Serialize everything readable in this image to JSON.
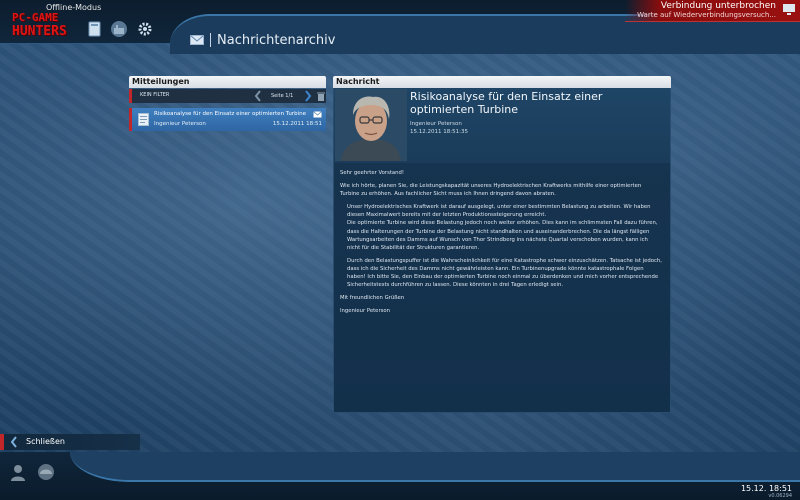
{
  "app": {
    "offline_mode": "Offline-Modus",
    "logo_line1": "PC-GAME",
    "logo_line2": "HUNTERS"
  },
  "connection": {
    "title": "Verbindung unterbrochen",
    "subtitle": "Warte auf Wiederverbindungsversuch..."
  },
  "header": {
    "title": "Nachrichtenarchiv"
  },
  "messages_panel": {
    "title": "Mitteilungen",
    "filter_label": "KEIN FILTER",
    "page_label": "Seite 1/1",
    "items": [
      {
        "subject": "Risikoanalyse für den Einsatz einer optimierten Turbine",
        "sender": "Ingenieur Peterson",
        "date": "15.12.2011 18:51"
      }
    ]
  },
  "message_panel": {
    "title": "Nachricht",
    "subject": "Risikoanalyse für den Einsatz einer optimierten Turbine",
    "sender": "Ingenieur Peterson",
    "timestamp": "15.12.2011 18:51:35",
    "greeting": "Sehr geehrter Vorstand!",
    "para1": "Wie ich hörte, planen Sie, die Leistungskapazität unseres Hydroelektrischen Kraftwerks mithilfe einer optimierten Turbine zu erhöhen. Aus fachlicher Sicht muss ich Ihnen dringend davon abraten.",
    "para2": "Unser Hydroelektrisches Kraftwerk ist darauf ausgelegt, unter einer bestimmten Belastung zu arbeiten. Wir haben diesen Maximalwert bereits mit der letzten Produktionssteigerung erreicht.",
    "para3": "Die optimierte Turbine wird diese Belastung jedoch noch weiter erhöhen. Dies kann im schlimmsten Fall dazu führen, dass die Halterungen der Turbine der Belastung nicht standhalten und auseinanderbrechen. Die da längst fälligen Wartungsarbeiten des Damms auf Wunsch von Thor Strindberg ins nächste Quartal verschoben wurden, kann ich nicht für die Stabilität der Strukturen garantieren.",
    "para4": "Durch den Belastungspuffer ist die Wahrscheinlichkeit für eine Katastrophe schwer einzuschätzen. Tatsache ist jedoch, dass ich die Sicherheit des Damms nicht gewährleisten kann. Ein Turbinenupgrade könnte katastrophale Folgen haben! Ich bitte Sie, den Einbau der optimierten Turbine noch einmal zu überdenken und mich vorher entsprechende Sicherheitstests durchführen zu lassen. Diese könnten in drei Tagen erledigt sein.",
    "closing": "Mit freundlichen Grüßen",
    "signature": "Ingenieur Peterson"
  },
  "footer": {
    "close_label": "Schließen",
    "clock": "15.12. 18:51",
    "version": "v0.06294"
  },
  "colors": {
    "accent_red": "#c0262a",
    "selected_item": "#3f7fc0",
    "panel_bg": "#173450"
  }
}
